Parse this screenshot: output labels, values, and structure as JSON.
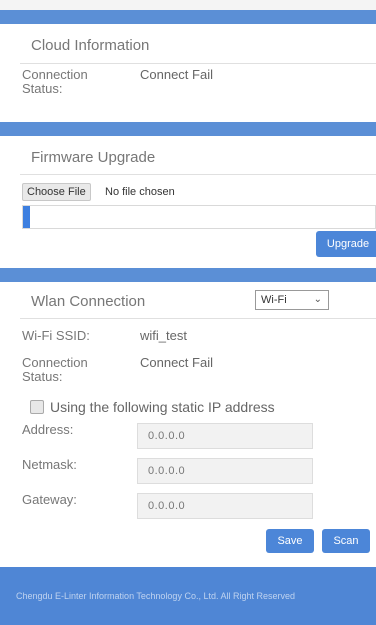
{
  "cloud": {
    "title": "Cloud Information",
    "connection_label": "Connection Status:",
    "connection_value": "Connect Fail"
  },
  "firmware": {
    "title": "Firmware Upgrade",
    "choose_file_label": "Choose File",
    "file_status": "No file chosen",
    "progress_fraction": 0.02,
    "upgrade_label": "Upgrade"
  },
  "wlan": {
    "title": "Wlan Connection",
    "mode_selected": "Wi-Fi",
    "ssid_label": "Wi-Fi SSID:",
    "ssid_value": "wifi_test",
    "connection_label": "Connection Status:",
    "connection_value": "Connect Fail",
    "static_ip_label": "Using the following static IP address",
    "address_label": "Address:",
    "address_value": "0.0.0.0",
    "netmask_label": "Netmask:",
    "netmask_value": "0.0.0.0",
    "gateway_label": "Gateway:",
    "gateway_value": "0.0.0.0",
    "save_label": "Save",
    "scan_label": "Scan"
  },
  "footer": {
    "text": "Chengdu E-Linter Information Technology Co., Ltd. All Right Reserved"
  },
  "colors": {
    "accent": "#4c86d8",
    "band": "#5b8fd6",
    "footer": "#4f86d5"
  }
}
